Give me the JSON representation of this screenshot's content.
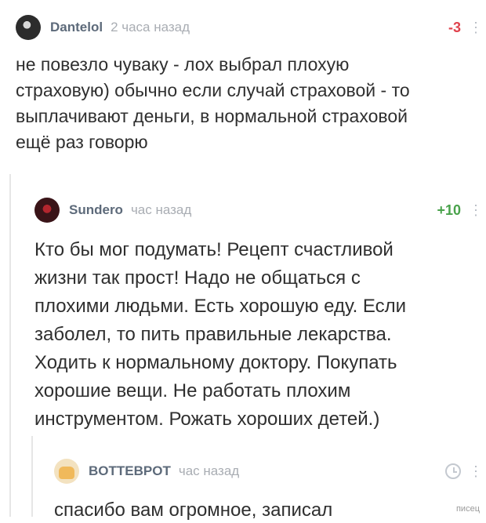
{
  "comments": [
    {
      "author": "Dantelol",
      "time": "2 часа назад",
      "rating": "-3",
      "text": "не повезло чуваку - лох выбрал плохую\nстраховую) обычно если случай страховой - то\nвыплачивают деньги, в нормальной страховой\nещё раз говорю"
    },
    {
      "author": "Sundero",
      "time": "час назад",
      "rating": "+10",
      "text": "Кто бы мог подумать! Рецепт счастливой\nжизни так прост! Надо не общаться с\nплохими людьми. Есть хорошую еду. Если\nзаболел, то пить правильные лекарства.\nХодить к нормальному доктору. Покупать\nхорошие вещи. Не работать плохим\nинструментом. Рожать хороших детей.)"
    },
    {
      "author": "BOTTEBPOT",
      "time": "час назад",
      "text": "спасибо вам огромное, записал"
    }
  ],
  "more_glyph": "⋮",
  "watermark": "писец",
  "colors": {
    "negative": "#e0424d",
    "positive": "#49a24b",
    "author": "#5d6a7a",
    "time": "#a9adb3"
  },
  "icons": [
    "avatar",
    "clock-icon",
    "more-icon"
  ]
}
